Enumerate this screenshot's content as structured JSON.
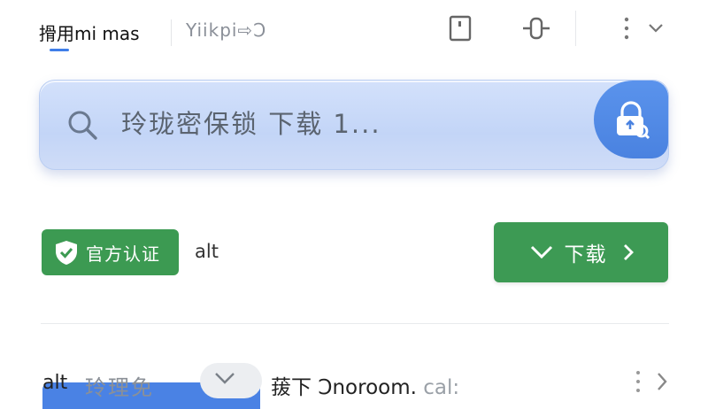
{
  "tabs": {
    "active_label": "搰用mi mas",
    "inactive_label": "Yiikpi⇨Ͻ"
  },
  "toolbar": {
    "icons": [
      "door-icon",
      "pin-icon",
      "more-vert-icon",
      "chevron-down-icon"
    ]
  },
  "search": {
    "placeholder": "玲珑密保锁 下载 1...",
    "value": ""
  },
  "badge": {
    "label": "官方认证"
  },
  "alt_text": "alt",
  "download": {
    "label": "下载"
  },
  "list_item": {
    "alt": "alt",
    "name": "玲理免",
    "desc_main": "菝下",
    "desc_link": "Ͻnoroom.",
    "desc_tail": "cal:"
  },
  "colors": {
    "accent_blue": "#4a82e4",
    "green": "#3c9a52",
    "search_bg": "#c9d9f7"
  }
}
